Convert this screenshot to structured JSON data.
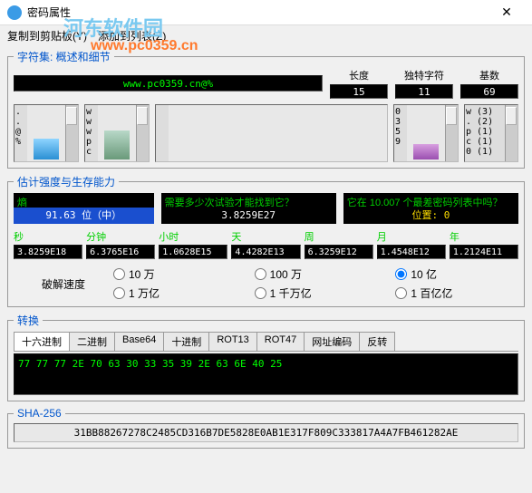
{
  "window": {
    "title": "密码属性",
    "close": "✕"
  },
  "watermark": {
    "line1": "河东软件园",
    "line2": "www.pc0359.cn"
  },
  "menu": {
    "copy": "复制到剪贴板(Y)",
    "add": "添加到列表(Z)"
  },
  "charset": {
    "legend": "字符集: 概述和细节"
  },
  "password": "www.pc0359.cn@%",
  "stats": {
    "length": {
      "label": "长度",
      "value": "15"
    },
    "unique": {
      "label": "独特字符",
      "value": "11"
    },
    "base": {
      "label": "基数",
      "value": "69"
    }
  },
  "bars": {
    "b1": {
      "chars": ".\n.\n@\n%"
    },
    "b2": {
      "chars": "w\nw\nw\np\nc"
    },
    "b3": {
      "chars": ""
    },
    "b4": {
      "chars": "0\n3\n5\n9"
    },
    "b5": {
      "chars": "w (3)\n. (2)\np (1)\nc (1)\n0 (1)"
    }
  },
  "strength": {
    "legend": "估计强度与生存能力",
    "entropy": {
      "label": "熵",
      "value": "91.63 位（中）"
    },
    "attempts": {
      "label": "需要多少次试验才能找到它？",
      "value": "3.8259E27"
    },
    "rank": {
      "label": "它在 10.007 个最差密码列表中吗？",
      "value": "位置: 0"
    }
  },
  "times": {
    "sec": {
      "label": "秒",
      "value": "3.8259E18"
    },
    "min": {
      "label": "分钟",
      "value": "6.3765E16"
    },
    "hr": {
      "label": "小时",
      "value": "1.0628E15"
    },
    "day": {
      "label": "天",
      "value": "4.4282E13"
    },
    "week": {
      "label": "周",
      "value": "6.3259E12"
    },
    "month": {
      "label": "月",
      "value": "1.4548E12"
    },
    "year": {
      "label": "年",
      "value": "1.2124E11"
    }
  },
  "speed": {
    "label": "破解速度",
    "r1": "10 万",
    "r2": "100 万",
    "r3": "10 亿",
    "r4": "1 万亿",
    "r5": "1 千万亿",
    "r6": "1 百亿亿"
  },
  "convert": {
    "legend": "转换",
    "tabs": {
      "hex": "十六进制",
      "bin": "二进制",
      "b64": "Base64",
      "dec": "十进制",
      "rot13": "ROT13",
      "rot47": "ROT47",
      "url": "网址编码",
      "rev": "反转"
    },
    "output": "77 77 77 2E 70 63 30 33 35 39 2E 63 6E 40 25"
  },
  "sha": {
    "legend": "SHA-256",
    "value": "31BB88267278C2485CD316B7DE5828E0AB1E317F809C333817A4A7FB461282AE"
  }
}
